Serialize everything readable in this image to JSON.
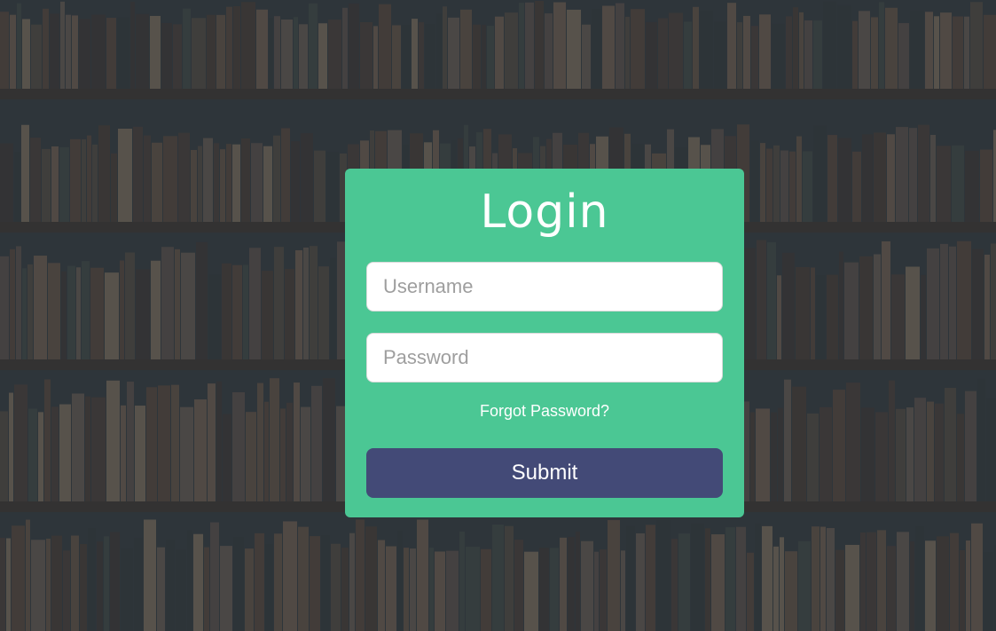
{
  "theme": {
    "card_color": "#4bc794",
    "button_color": "#434a77",
    "background_tint": "#2f353b"
  },
  "login": {
    "title": "Login",
    "username_placeholder": "Username",
    "password_placeholder": "Password",
    "forgot_label": "Forgot Password?",
    "submit_label": "Submit"
  }
}
